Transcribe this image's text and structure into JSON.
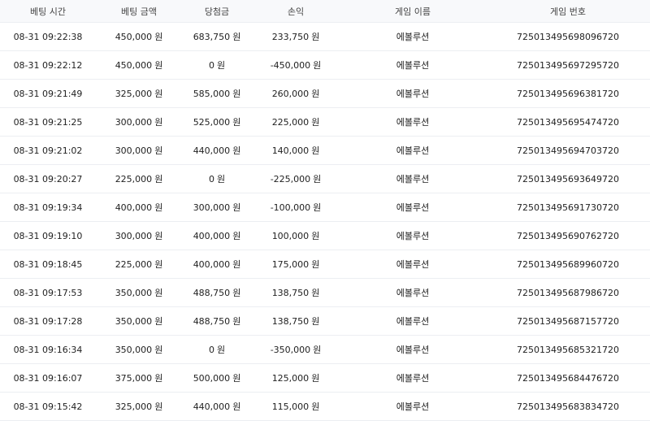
{
  "columns": [
    "베팅 시간",
    "베팅 금액",
    "당첨금",
    "손익",
    "게임 이름",
    "게임 번호"
  ],
  "currency": "원",
  "rows": [
    {
      "time": "08-31 09:22:38",
      "bet": "450,000",
      "win": "683,750",
      "pl": "233,750",
      "game": "에볼루션",
      "id": "725013495698096720"
    },
    {
      "time": "08-31 09:22:12",
      "bet": "450,000",
      "win": "0",
      "pl": "-450,000",
      "game": "에볼루션",
      "id": "725013495697295720"
    },
    {
      "time": "08-31 09:21:49",
      "bet": "325,000",
      "win": "585,000",
      "pl": "260,000",
      "game": "에볼루션",
      "id": "725013495696381720"
    },
    {
      "time": "08-31 09:21:25",
      "bet": "300,000",
      "win": "525,000",
      "pl": "225,000",
      "game": "에볼루션",
      "id": "725013495695474720"
    },
    {
      "time": "08-31 09:21:02",
      "bet": "300,000",
      "win": "440,000",
      "pl": "140,000",
      "game": "에볼루션",
      "id": "725013495694703720"
    },
    {
      "time": "08-31 09:20:27",
      "bet": "225,000",
      "win": "0",
      "pl": "-225,000",
      "game": "에볼루션",
      "id": "725013495693649720"
    },
    {
      "time": "08-31 09:19:34",
      "bet": "400,000",
      "win": "300,000",
      "pl": "-100,000",
      "game": "에볼루션",
      "id": "725013495691730720"
    },
    {
      "time": "08-31 09:19:10",
      "bet": "300,000",
      "win": "400,000",
      "pl": "100,000",
      "game": "에볼루션",
      "id": "725013495690762720"
    },
    {
      "time": "08-31 09:18:45",
      "bet": "225,000",
      "win": "400,000",
      "pl": "175,000",
      "game": "에볼루션",
      "id": "725013495689960720"
    },
    {
      "time": "08-31 09:17:53",
      "bet": "350,000",
      "win": "488,750",
      "pl": "138,750",
      "game": "에볼루션",
      "id": "725013495687986720"
    },
    {
      "time": "08-31 09:17:28",
      "bet": "350,000",
      "win": "488,750",
      "pl": "138,750",
      "game": "에볼루션",
      "id": "725013495687157720"
    },
    {
      "time": "08-31 09:16:34",
      "bet": "350,000",
      "win": "0",
      "pl": "-350,000",
      "game": "에볼루션",
      "id": "725013495685321720"
    },
    {
      "time": "08-31 09:16:07",
      "bet": "375,000",
      "win": "500,000",
      "pl": "125,000",
      "game": "에볼루션",
      "id": "725013495684476720"
    },
    {
      "time": "08-31 09:15:42",
      "bet": "325,000",
      "win": "440,000",
      "pl": "115,000",
      "game": "에볼루션",
      "id": "725013495683834720"
    }
  ]
}
